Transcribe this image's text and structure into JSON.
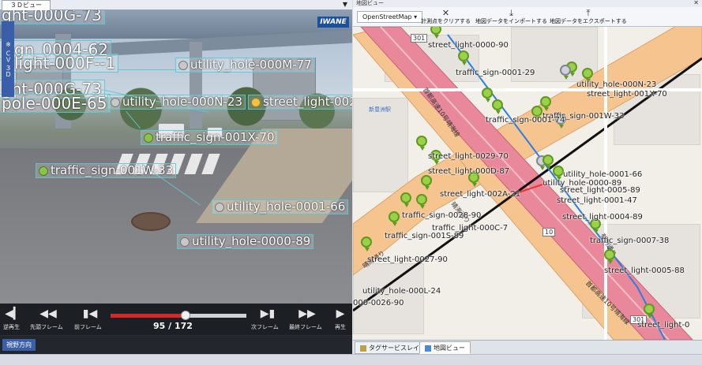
{
  "left_pane": {
    "tab_title": "３Ｄビュー",
    "menu_arrow": "▼",
    "brand_badge": "IWANE",
    "side_tag": "※ ＣＶ ３Ｄ",
    "labels": [
      {
        "id": "l1",
        "text": "ght-000G-73",
        "icon": "none",
        "size": "big"
      },
      {
        "id": "l2",
        "text": "sign_0004-62",
        "icon": "none",
        "size": "big"
      },
      {
        "id": "l3",
        "text": "light-000F--1",
        "icon": "none",
        "size": "big"
      },
      {
        "id": "l4",
        "text": "utility_hole-000M-77",
        "icon": "gray",
        "size": "mid"
      },
      {
        "id": "l5",
        "text": "pole-000E-65",
        "icon": "none",
        "size": "big"
      },
      {
        "id": "l6",
        "text": "utility_hole-000N-23",
        "icon": "gray",
        "size": "mid"
      },
      {
        "id": "l7",
        "text": "street_light-002",
        "icon": "yellow",
        "size": "mid"
      },
      {
        "id": "l8",
        "text": "traffic_sign-001X-70",
        "icon": "green",
        "size": "mid"
      },
      {
        "id": "l9",
        "text": "traffic_sign-001W-33",
        "icon": "green",
        "size": "mid"
      },
      {
        "id": "l10",
        "text": "utility_hole-0001-66",
        "icon": "gray",
        "size": "mid"
      },
      {
        "id": "l11",
        "text": "utility_hole-0000-89",
        "icon": "gray",
        "size": "mid"
      }
    ],
    "player": {
      "buttons": [
        {
          "id": "reverse",
          "glyph": "◀▎",
          "caption": "逆再生"
        },
        {
          "id": "first",
          "glyph": "◀◀",
          "caption": "先頭フレーム"
        },
        {
          "id": "prev",
          "glyph": "▮◀",
          "caption": "前フレーム"
        },
        {
          "id": "next",
          "glyph": "▶▮",
          "caption": "次フレーム"
        },
        {
          "id": "last",
          "glyph": "▶▶",
          "caption": "最終フレーム"
        },
        {
          "id": "play",
          "glyph": "▶",
          "caption": "再生"
        }
      ],
      "current_frame": 95,
      "total_frames": 172,
      "counter_text": "95 / 172",
      "progress": 0.55
    },
    "view_direction_label": "視野方向"
  },
  "right_pane": {
    "title": "地図ビュー",
    "close": "✕",
    "toolbar": {
      "basemap_value": "OpenStreetMap ▾",
      "buttons": [
        {
          "id": "clear-points",
          "glyph": "✕",
          "label": "計測点をクリアする"
        },
        {
          "id": "import-map",
          "glyph": "⤓",
          "label": "地図データをインポートする"
        },
        {
          "id": "export-map",
          "glyph": "⤒",
          "label": "地図データをエクスポートする"
        }
      ]
    },
    "map": {
      "feature_labels": [
        "street_light-0000-90",
        "traffic_sign-0001-29",
        "utility_hole-000N-23",
        "street_light-001X-70",
        "traffic_sign-001W-33",
        "traffic_sign-0001-74",
        "street_light-0029-70",
        "street_light-000D-87",
        "utility_hole-0001-66",
        "utility_hole-0000-89",
        "street_light-0005-89",
        "street_light-0001-47",
        "street_light-002A-21",
        "traffic_sign-0028-90",
        "traffic_light-000C-7",
        "street_light-0004-89",
        "traffic_sign-0007-38",
        "traffic_sign-001S-89",
        "street_light-0027-90",
        "street_light-0005-88",
        "utility_hole-000L-24",
        "000-0026-90",
        "street_light-0"
      ],
      "road_texts": [
        "首都高速10号晴海線",
        "首都高速10号晴海線",
        "晴海通り",
        "晴海通り",
        "有明通り",
        "新豊洲駅"
      ],
      "shields": [
        "301",
        "10",
        "301"
      ]
    },
    "tabs": [
      {
        "id": "tag-service-layer",
        "label": "タグサービスレイヤー",
        "active": false
      },
      {
        "id": "map-view",
        "label": "地図ビュー",
        "active": true
      }
    ]
  },
  "colors": {
    "label_border": "#5ac8d2",
    "highway_pink": "#e8889a",
    "trunk_orange": "#f5c48f",
    "route_blue": "#2b7fe0",
    "progress_red": "#d62828",
    "pin_green": "#9ad04a"
  }
}
